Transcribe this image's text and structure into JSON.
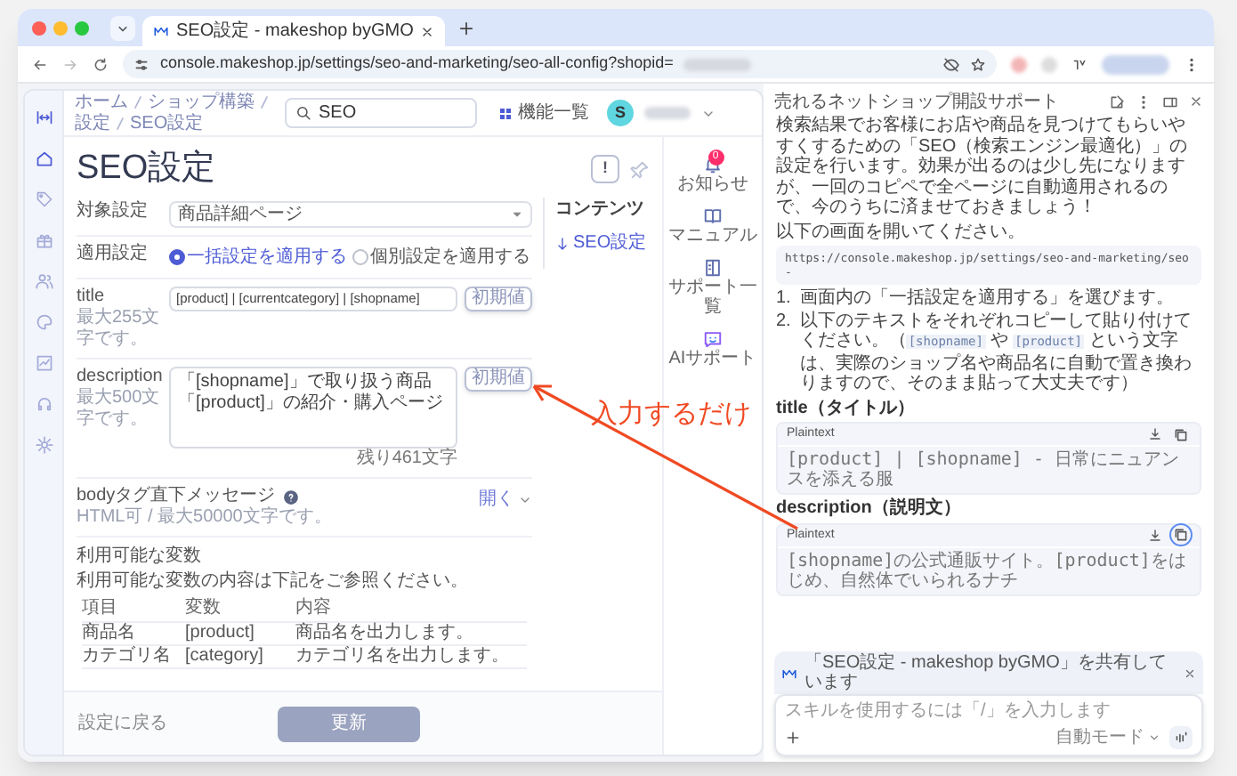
{
  "browser": {
    "tab_title": "SEO設定 - makeshop byGMO",
    "url": "console.makeshop.jp/settings/seo-and-marketing/seo-all-config?shopid="
  },
  "header": {
    "breadcrumbs": [
      "ホーム",
      "ショップ構築",
      "設定",
      "SEO設定"
    ],
    "search_value": "SEO",
    "menu_label": "機能一覧",
    "avatar_letter": "S"
  },
  "page": {
    "title": "SEO設定",
    "help_button": "!"
  },
  "form": {
    "target": {
      "label": "対象設定",
      "value": "商品詳細ページ"
    },
    "apply": {
      "label": "適用設定",
      "options": [
        {
          "label": "一括設定を適用する",
          "selected": true
        },
        {
          "label": "個別設定を適用する",
          "selected": false
        }
      ]
    },
    "title": {
      "label": "title",
      "hint": "最大255文字です。",
      "value": "[product] | [currentcategory] | [shopname]",
      "reset_button": "初期値"
    },
    "description": {
      "label": "description",
      "hint": "最大500文字です。",
      "value": "「[shopname]」で取り扱う商品「[product]」の紹介・購入ページ",
      "reset_button": "初期値",
      "counter": "残り461文字"
    },
    "body_message": {
      "label": "bodyタグ直下メッセージ",
      "hint": "HTML可 / 最大50000文字です。",
      "toggle": "開く"
    }
  },
  "variables": {
    "heading": "利用可能な変数",
    "note": "利用可能な変数の内容は下記をご参照ください。",
    "columns": [
      "項目",
      "変数",
      "内容"
    ],
    "rows": [
      [
        "商品名",
        "[product]",
        "商品名を出力します。"
      ],
      [
        "カテゴリ名",
        "[category]",
        "カテゴリ名を出力します。"
      ]
    ]
  },
  "toc": {
    "heading": "コンテンツ",
    "items": [
      {
        "label": "SEO設定",
        "selected": true
      }
    ]
  },
  "utility": [
    {
      "label": "お知らせ",
      "badge": "0"
    },
    {
      "label": "マニュアル"
    },
    {
      "label": "サポート一覧"
    },
    {
      "label": "AIサポート"
    }
  ],
  "footer": {
    "back_link": "設定に戻る",
    "submit": "更新",
    "submit_disabled": true
  },
  "annotation": {
    "text": "入力するだけ"
  },
  "assistant": {
    "title": "売れるネットショップ開設サポート",
    "intro": "検索結果でお客様にお店や商品を見つけてもらいやすくするための「SEO（検索エンジン最適化）」の設定を行います。効果が出るのは少し先になりますが、一回のコピペで全ページに自動適用されるので、今のうちに済ませておきましょう！",
    "instruction": "以下の画面を開いてください。",
    "url_code": "https://console.makeshop.jp/settings/seo-and-marketing/seo-",
    "steps": [
      {
        "number": "1.",
        "parts": [
          {
            "kind": "text",
            "text": "画面内の「一括設定を適用する」を選びます。"
          }
        ]
      },
      {
        "number": "2.",
        "parts": [
          {
            "kind": "text",
            "text": "以下のテキストをそれぞれコピーして貼り付けてください。（"
          },
          {
            "kind": "code",
            "text": "[shopname]"
          },
          {
            "kind": "text",
            "text": " や "
          },
          {
            "kind": "code",
            "text": "[product]"
          },
          {
            "kind": "text",
            "text": " という文字は、実際のショップ名や商品名に自動で置き換わりますので、そのまま貼って大丈夫です）"
          }
        ]
      }
    ],
    "snippets": [
      {
        "heading": "title（タイトル）",
        "language": "Plaintext",
        "code": "[product] | [shopname] - 日常にニュアンスを添える服",
        "copy_focused": false
      },
      {
        "heading": "description（説明文）",
        "language": "Plaintext",
        "code": "[shopname]の公式通販サイト。[product]をはじめ、自然体でいられるナチ",
        "copy_focused": true
      }
    ],
    "shared_page": "「SEO設定 - makeshop byGMO」を共有しています",
    "input_placeholder": "スキルを使用するには「/」を入力します",
    "mode": "自動モード"
  }
}
